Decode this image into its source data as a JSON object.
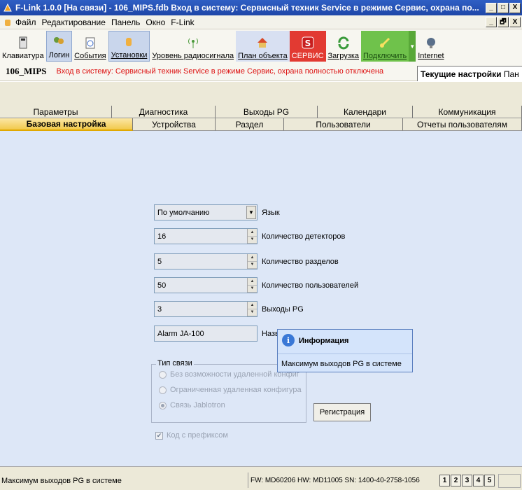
{
  "window": {
    "title": "F-Link 1.0.0 [На связи] - 106_MIPS.fdb Вход в систему: Сервисный техник Service в режиме Сервис, охрана по...",
    "buttons": [
      "_",
      "□",
      "X"
    ]
  },
  "menu": {
    "items": [
      "Файл",
      "Редактирование",
      "Панель",
      "Окно",
      "F-Link"
    ],
    "mdi_buttons": [
      "_",
      "🗗",
      "X"
    ]
  },
  "toolbar": {
    "buttons": [
      {
        "label": "Клавиатура",
        "icon": "keyboard-icon"
      },
      {
        "label": "Логин",
        "icon": "login-icon"
      },
      {
        "label": "События",
        "icon": "events-icon"
      },
      {
        "label": "Установки",
        "icon": "settings-icon"
      },
      {
        "label": "Уровень радиосигнала",
        "icon": "radio-signal-icon"
      },
      {
        "label": "План объекта",
        "icon": "house-icon"
      },
      {
        "label": "СЕРВИС",
        "icon": "service-icon"
      },
      {
        "label": "Загрузка",
        "icon": "download-icon"
      },
      {
        "label": "Подключить",
        "icon": "connect-icon"
      },
      {
        "label": "Internet",
        "icon": "internet-icon"
      }
    ]
  },
  "status": {
    "device": "106_MIPS",
    "login_message": "Вход в систему: Сервисный техник Service в режиме Сервис, охрана полностью отключена",
    "current_settings_tab": "Текущие настройки",
    "cut_tab": "Пан"
  },
  "tabs_row1": [
    "Параметры",
    "Диагностика",
    "Выходы PG",
    "Календари",
    "Коммуникация"
  ],
  "tabs_row2": [
    "Базовая настройка",
    "Устройства",
    "Раздел",
    "Пользователи",
    "Отчеты пользователям"
  ],
  "form": {
    "language": {
      "value": "По умолчанию",
      "label": "Язык"
    },
    "detectors": {
      "value": "16",
      "label": "Количество детекторов"
    },
    "sections": {
      "value": "5",
      "label": "Количество разделов"
    },
    "users": {
      "value": "50",
      "label": "Количество пользователей"
    },
    "pg_outputs": {
      "value": "3",
      "label": "Выходы PG"
    },
    "name": {
      "value": "Alarm JA-100",
      "label": "Назв"
    }
  },
  "connection": {
    "title": "Тип связи",
    "options": [
      "Без возможности удаленной конфиг",
      "Ограниченная удаленная конфигура",
      "Связь Jablotron"
    ],
    "selected": "Связь Jablotron",
    "register_label": "Регистрация"
  },
  "prefix": {
    "label": "Код с префиксом",
    "checked": true
  },
  "tooltip": {
    "title": "Информация",
    "message": "Максимум выходов PG в системе"
  },
  "statusbar": {
    "message": "Максимум выходов PG в системе",
    "info": "FW: MD60206 HW: MD11005 SN: 1400-40-2758-1056",
    "numbers": [
      "1",
      "2",
      "3",
      "4",
      "5"
    ]
  },
  "colors": {
    "title_bar": "#1e46a8",
    "active_tab": "#f2c94c",
    "content_bg": "#dde7f7",
    "error_text": "#dd1111",
    "service_button": "#e23a32",
    "connect_button": "#6fc24b"
  }
}
